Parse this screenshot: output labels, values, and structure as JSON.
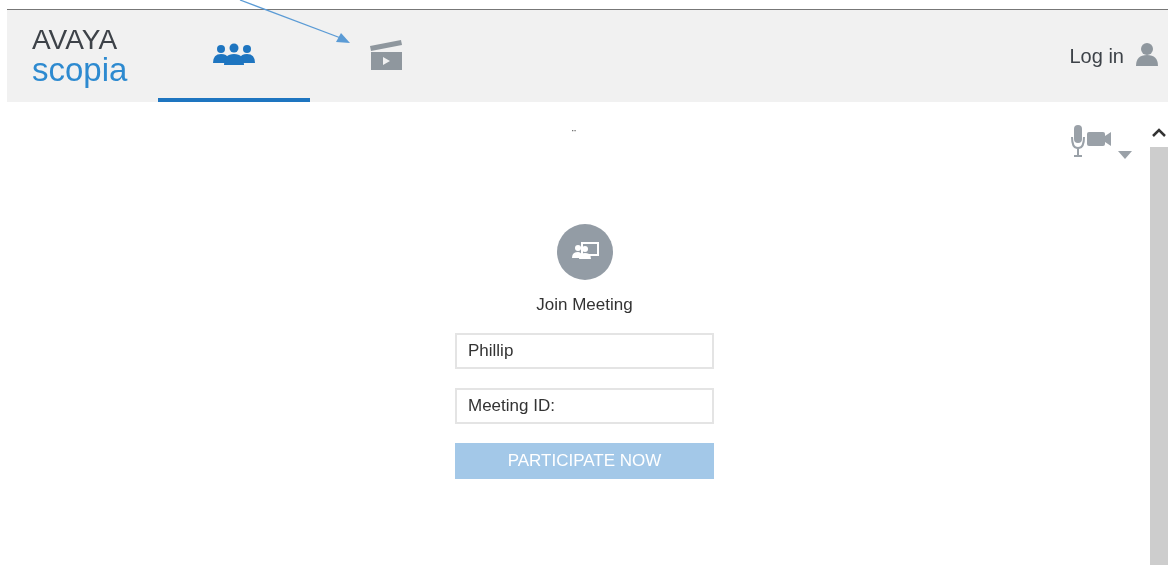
{
  "header": {
    "logo": {
      "brand": "AVAYA",
      "product": "scopia"
    },
    "tabs": [
      {
        "kind": "people",
        "selected": true
      },
      {
        "kind": "recordings",
        "selected": false
      }
    ],
    "login": "Log in"
  },
  "toolbar": {
    "status": "¨"
  },
  "join": {
    "title": "Join Meeting",
    "name_field": {
      "value": "Phillip"
    },
    "id_field": {
      "placeholder": "Meeting ID:"
    },
    "button": {
      "label": "PARTICIPATE NOW",
      "disabled": true
    }
  }
}
